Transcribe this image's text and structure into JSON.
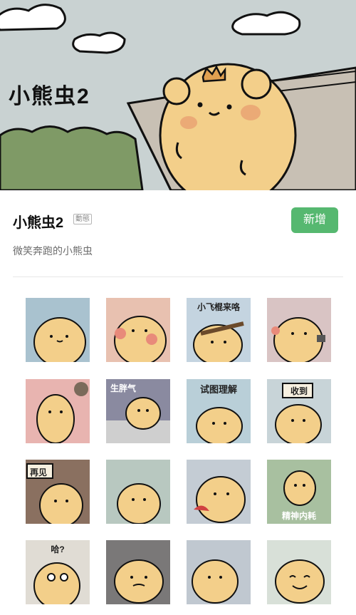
{
  "pack": {
    "banner_title": "小熊虫2",
    "title": "小熊虫2",
    "badge": "動態",
    "add_label": "新增",
    "description": "微笑奔跑的小熊虫"
  },
  "colors": {
    "accent": "#56b870",
    "bear": "#f3cf8a",
    "cheek": "#e8a070"
  },
  "stickers": [
    {
      "caption": ""
    },
    {
      "caption": ""
    },
    {
      "caption": "小飞棍来咯"
    },
    {
      "caption": ""
    },
    {
      "caption": ""
    },
    {
      "caption": "生胖气"
    },
    {
      "caption": "试图理解"
    },
    {
      "caption": "收到"
    },
    {
      "caption": "再见"
    },
    {
      "caption": ""
    },
    {
      "caption": ""
    },
    {
      "caption": "精神内耗"
    },
    {
      "caption": "哈?"
    },
    {
      "caption": ""
    },
    {
      "caption": ""
    },
    {
      "caption": ""
    }
  ]
}
